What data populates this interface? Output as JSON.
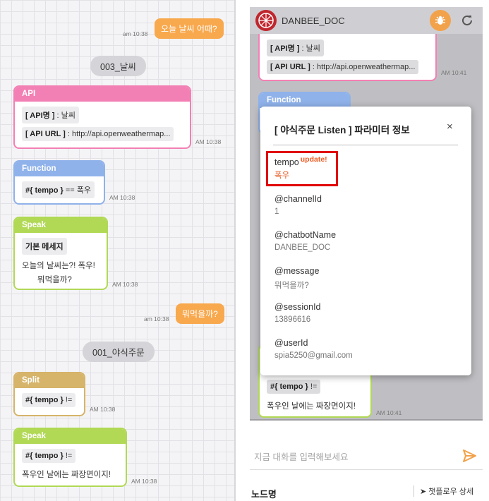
{
  "left": {
    "user_msg_1": "오늘 날씨 어때?",
    "user_time_1": "am 10:38",
    "divider_1": "003_날씨",
    "api_card": {
      "title": "API",
      "name_key": "[ API명 ]",
      "name_val": " : 날씨",
      "url_key": "[ API URL ]",
      "url_val": " : http://api.openweathermap...",
      "time": "AM 10:38"
    },
    "fn_card": {
      "title": "Function",
      "expr_key": "#{ tempo }",
      "expr_val": " == 폭우",
      "time": "AM 10:38"
    },
    "speak_card_1": {
      "title": "Speak",
      "tag": "기본 메세지",
      "line1": "오늘의 날씨는?! 폭우!",
      "line2": "뭐먹을까?",
      "time": "AM 10:38"
    },
    "user_msg_2": "뭐먹을까?",
    "user_time_2": "am 10:38",
    "divider_2": "001_야식주문",
    "split_card": {
      "title": "Split",
      "expr_key": "#{ tempo }",
      "expr_val": " !=",
      "time": "AM 10:38"
    },
    "speak_card_2": {
      "title": "Speak",
      "expr_key": "#{ tempo }",
      "expr_val": " !=",
      "line1": "폭우인 날에는 짜장면이지!",
      "time": "AM 10:38"
    }
  },
  "right": {
    "bot_name": "DANBEE_DOC",
    "bg_api": {
      "name_key": "[ API명 ]",
      "name_val": " : 날씨",
      "url_key": "[ API URL ]",
      "url_val": " : http://api.openweathermap...",
      "time": "AM 10:41"
    },
    "bg_fn_title": "Function",
    "bg_split": {
      "expr_key": "#{ tempo }",
      "expr_val": " !=",
      "line1": "폭우인 날에는 짜장면이지!",
      "time": "AM 10:41"
    },
    "composer_placeholder": "지금 대화를 입력해보세요",
    "node_label": "노드명",
    "flow_link": "챗플로우 상세"
  },
  "modal": {
    "title": "[ 야식주문 Listen ] 파라미터 정보",
    "close": "×",
    "params": [
      {
        "name": "tempo",
        "badge": "update!",
        "value": "폭우"
      },
      {
        "name": "@channelId",
        "value": "1"
      },
      {
        "name": "@chatbotName",
        "value": "DANBEE_DOC"
      },
      {
        "name": "@message",
        "value": "뭐먹을까?"
      },
      {
        "name": "@sessionId",
        "value": "13896616"
      },
      {
        "name": "@userId",
        "value": "spia5250@gmail.com"
      }
    ]
  },
  "colors": {
    "accent_orange": "#f8a84d",
    "api": "#f380b4",
    "function": "#8fb2ea",
    "speak": "#b1d955",
    "split": "#d6b46a",
    "highlight_red": "#e00000"
  },
  "icons": [
    "bug-icon",
    "refresh-icon",
    "send-icon",
    "close-icon",
    "navigation-arrow-icon",
    "bot-logo-icon"
  ]
}
